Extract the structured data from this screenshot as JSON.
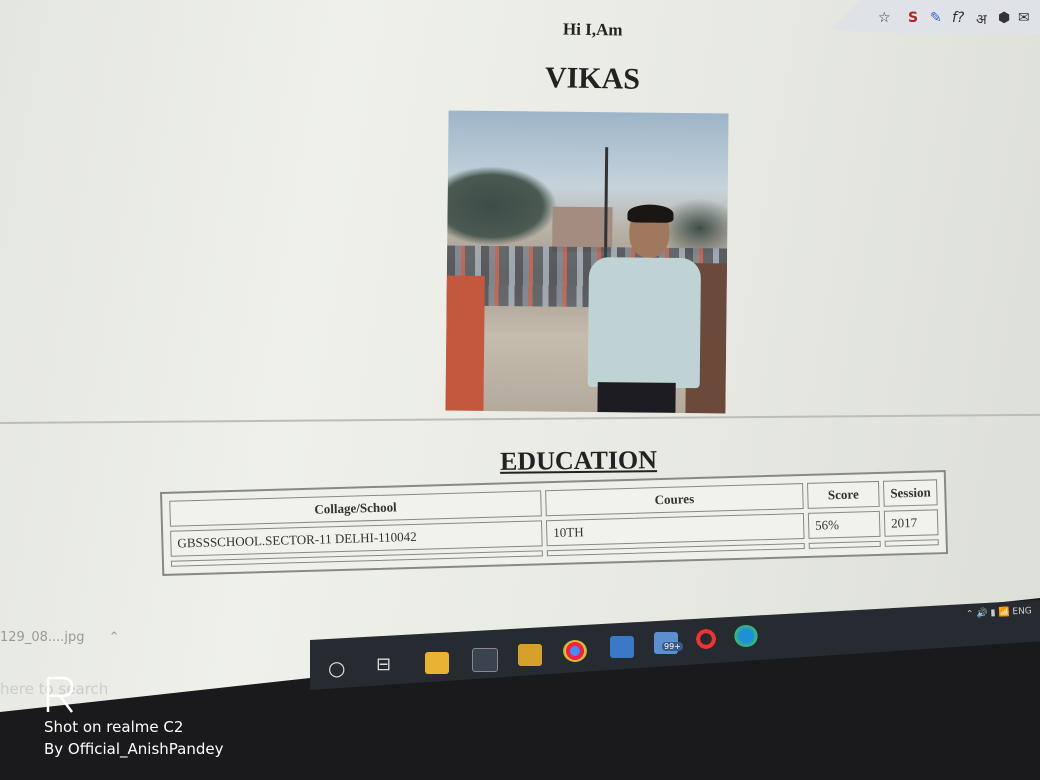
{
  "page": {
    "greeting": "Hi I,Am",
    "name": "VIKAS",
    "section_title": "EDUCATION"
  },
  "table": {
    "headers": [
      "Collage/School",
      "Coures",
      "Score",
      "Session"
    ],
    "rows": [
      [
        "GBSSSCHOOL.SECTOR-11 DELHI-110042",
        "10TH",
        "56%",
        "2017"
      ]
    ]
  },
  "browser_extensions": [
    "star-icon",
    "s-extension-icon",
    "pen-icon",
    "font-icon",
    "hindi-input-icon",
    "hex-icon",
    "mail-icon"
  ],
  "extension_glyphs": {
    "font": "f?",
    "hindi": "अ"
  },
  "taskbar": {
    "download_file": "129_08....jpg",
    "search_text": "here to search",
    "badge": "99+",
    "tray_text": "ENG"
  },
  "watermark": {
    "line1": "Shot on realme C2",
    "line2": "By Official_AnishPandey"
  },
  "colors": {
    "page_bg": "#eceee8",
    "text": "#222222",
    "taskbar": "#262a31"
  }
}
